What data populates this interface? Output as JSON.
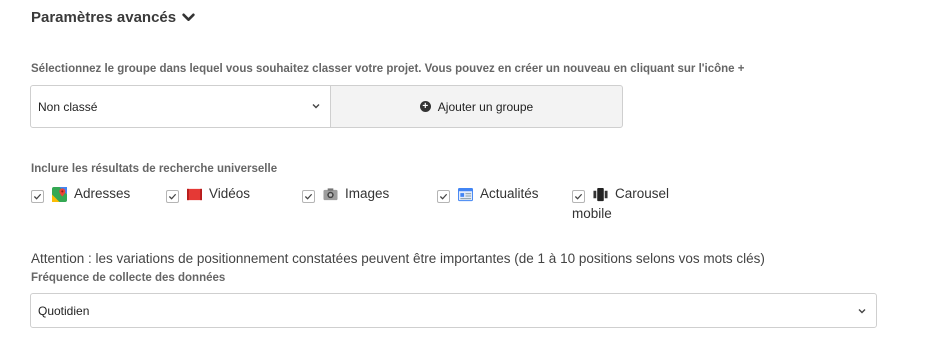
{
  "advanced": {
    "title": "Paramètres avancés",
    "toggle_icon": "chevron-down-icon"
  },
  "group": {
    "help_text": "Sélectionnez le groupe dans lequel vous souhaitez classer votre projet. Vous pouvez en créer un nouveau en cliquant sur l'icône +",
    "selected": "Non classé",
    "add_button_label": "Ajouter un groupe",
    "add_icon": "plus-circle-icon"
  },
  "universal": {
    "label": "Inclure les résultats de recherche universelle",
    "options": [
      {
        "label": "Adresses",
        "icon": "maps-pin-icon",
        "checked": true
      },
      {
        "label": "Vidéos",
        "icon": "video-icon",
        "checked": true
      },
      {
        "label": "Images",
        "icon": "camera-icon",
        "checked": true
      },
      {
        "label": "Actualités",
        "icon": "news-icon",
        "checked": true
      },
      {
        "label": "Carousel",
        "label_line2": "mobile",
        "icon": "carousel-icon",
        "checked": true
      }
    ]
  },
  "warning_text": "Attention : les variations de positionnement constatées peuvent être importantes (de 1 à 10 positions selons vos mots clés)",
  "frequency": {
    "label": "Fréquence de collecte des données",
    "selected": "Quotidien"
  },
  "colors": {
    "text": "#333333",
    "muted_label": "#666666",
    "border": "#cfcfcf",
    "button_bg": "#f3f3f3",
    "video_red": "#e53935"
  }
}
